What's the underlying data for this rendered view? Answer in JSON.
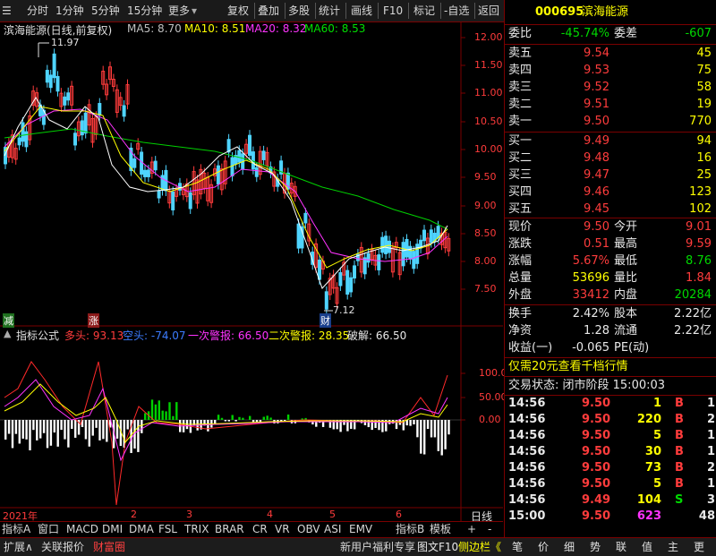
{
  "toolbar": {
    "items": [
      "分时",
      "1分钟",
      "5分钟",
      "15分钟",
      "更多",
      "复权",
      "叠加",
      "多股",
      "统计",
      "画线",
      "F10",
      "标记",
      "-自选",
      "返回"
    ]
  },
  "chart": {
    "title": "滨海能源(日线,前复权)",
    "ma": [
      {
        "label": "MA5: 8.70",
        "color": "#ffffff"
      },
      {
        "label": "MA10: 8.51",
        "color": "#ffff00"
      },
      {
        "label": "MA20: 8.32",
        "color": "#ff33ff"
      },
      {
        "label": "MA60: 8.53",
        "color": "#00e000"
      }
    ],
    "price_high_marker": "11.97",
    "price_low_marker": "7.12",
    "y_axis_labels": [
      "12.00",
      "11.50",
      "11.00",
      "10.50",
      "10.00",
      "9.50",
      "9.00",
      "8.50",
      "8.00",
      "7.50"
    ],
    "tag_jian": "减",
    "tag_zhang": "涨",
    "tag_cai": "财",
    "indicator": {
      "name": "指标公式",
      "items": [
        {
          "label": "多头: 93.13",
          "color": "#ff3c3c"
        },
        {
          "label": "空头: -74.07",
          "color": "#3c7cff"
        },
        {
          "label": "一次警报: 66.50",
          "color": "#ff33ff"
        },
        {
          "label": "二次警报: 28.35",
          "color": "#ffff00"
        },
        {
          "label": "破解: 66.50",
          "color": "#e8e8e8"
        }
      ],
      "y_axis_labels": [
        "100.0",
        "50.00",
        "0.00"
      ]
    },
    "x_axis": {
      "year": "2021年",
      "months": [
        "2",
        "3",
        "4",
        "5",
        "6"
      ],
      "right_label": "日线"
    }
  },
  "tabs": [
    "指标A",
    "窗口",
    "MACD",
    "DMI",
    "DMA",
    "FSL",
    "TRIX",
    "BRAR",
    "CR",
    "VR",
    "OBV",
    "ASI",
    "EMV",
    "指标B",
    "模板",
    "+",
    "-"
  ],
  "status": {
    "left": [
      "扩展∧",
      "关联报价",
      "财富圈"
    ],
    "right": [
      "新用户福利专享",
      "图文F10",
      "侧边栏《"
    ],
    "panel_tabs": [
      "笔",
      "价",
      "细",
      "势",
      "联",
      "值",
      "主",
      "更"
    ]
  },
  "quote": {
    "code": "000695",
    "name": "滨海能源",
    "weibi_label": "委比",
    "weibi": "-45.74%",
    "weicha_label": "委差",
    "weicha": "-607",
    "asks": [
      {
        "label": "卖五",
        "price": "9.54",
        "vol": "45"
      },
      {
        "label": "卖四",
        "price": "9.53",
        "vol": "75"
      },
      {
        "label": "卖三",
        "price": "9.52",
        "vol": "58"
      },
      {
        "label": "卖二",
        "price": "9.51",
        "vol": "19"
      },
      {
        "label": "卖一",
        "price": "9.50",
        "vol": "770"
      }
    ],
    "bids": [
      {
        "label": "买一",
        "price": "9.49",
        "vol": "94"
      },
      {
        "label": "买二",
        "price": "9.48",
        "vol": "16"
      },
      {
        "label": "买三",
        "price": "9.47",
        "vol": "25"
      },
      {
        "label": "买四",
        "price": "9.46",
        "vol": "123"
      },
      {
        "label": "买五",
        "price": "9.45",
        "vol": "102"
      }
    ],
    "stats": [
      {
        "l1": "现价",
        "v1": "9.50",
        "c1": "red",
        "l2": "今开",
        "v2": "9.01",
        "c2": "red"
      },
      {
        "l1": "涨跌",
        "v1": "0.51",
        "c1": "red",
        "l2": "最高",
        "v2": "9.59",
        "c2": "red"
      },
      {
        "l1": "涨幅",
        "v1": "5.67%",
        "c1": "red",
        "l2": "最低",
        "v2": "8.76",
        "c2": "grn"
      },
      {
        "l1": "总量",
        "v1": "53696",
        "c1": "yel",
        "l2": "量比",
        "v2": "1.84",
        "c2": "red"
      },
      {
        "l1": "外盘",
        "v1": "33412",
        "c1": "red",
        "l2": "内盘",
        "v2": "20284",
        "c2": "grn"
      }
    ],
    "fin": [
      {
        "l1": "换手",
        "v1": "2.42%",
        "l2": "股本",
        "v2": "2.22亿"
      },
      {
        "l1": "净资",
        "v1": "1.28",
        "l2": "流通",
        "v2": "2.22亿"
      },
      {
        "l1": "收益(一)",
        "v1": "-0.065",
        "l2": "PE(动)",
        "v2": ""
      }
    ],
    "promo": "仅需20元查看千档行情",
    "trade_state": "交易状态: 闭市阶段 15:00:03",
    "ticks": [
      {
        "t": "14:56",
        "p": "9.50",
        "v": "1",
        "s": "B",
        "n": "1",
        "c": "red"
      },
      {
        "t": "14:56",
        "p": "9.50",
        "v": "220",
        "s": "B",
        "n": "2",
        "c": "red"
      },
      {
        "t": "14:56",
        "p": "9.50",
        "v": "5",
        "s": "B",
        "n": "1",
        "c": "red"
      },
      {
        "t": "14:56",
        "p": "9.50",
        "v": "30",
        "s": "B",
        "n": "1",
        "c": "red"
      },
      {
        "t": "14:56",
        "p": "9.50",
        "v": "73",
        "s": "B",
        "n": "2",
        "c": "red"
      },
      {
        "t": "14:56",
        "p": "9.50",
        "v": "5",
        "s": "B",
        "n": "1",
        "c": "red"
      },
      {
        "t": "14:56",
        "p": "9.49",
        "v": "104",
        "s": "S",
        "n": "3",
        "c": "grn"
      },
      {
        "t": "15:00",
        "p": "9.50",
        "v": "623",
        "s": "",
        "n": "48",
        "c": "mag"
      }
    ]
  }
}
